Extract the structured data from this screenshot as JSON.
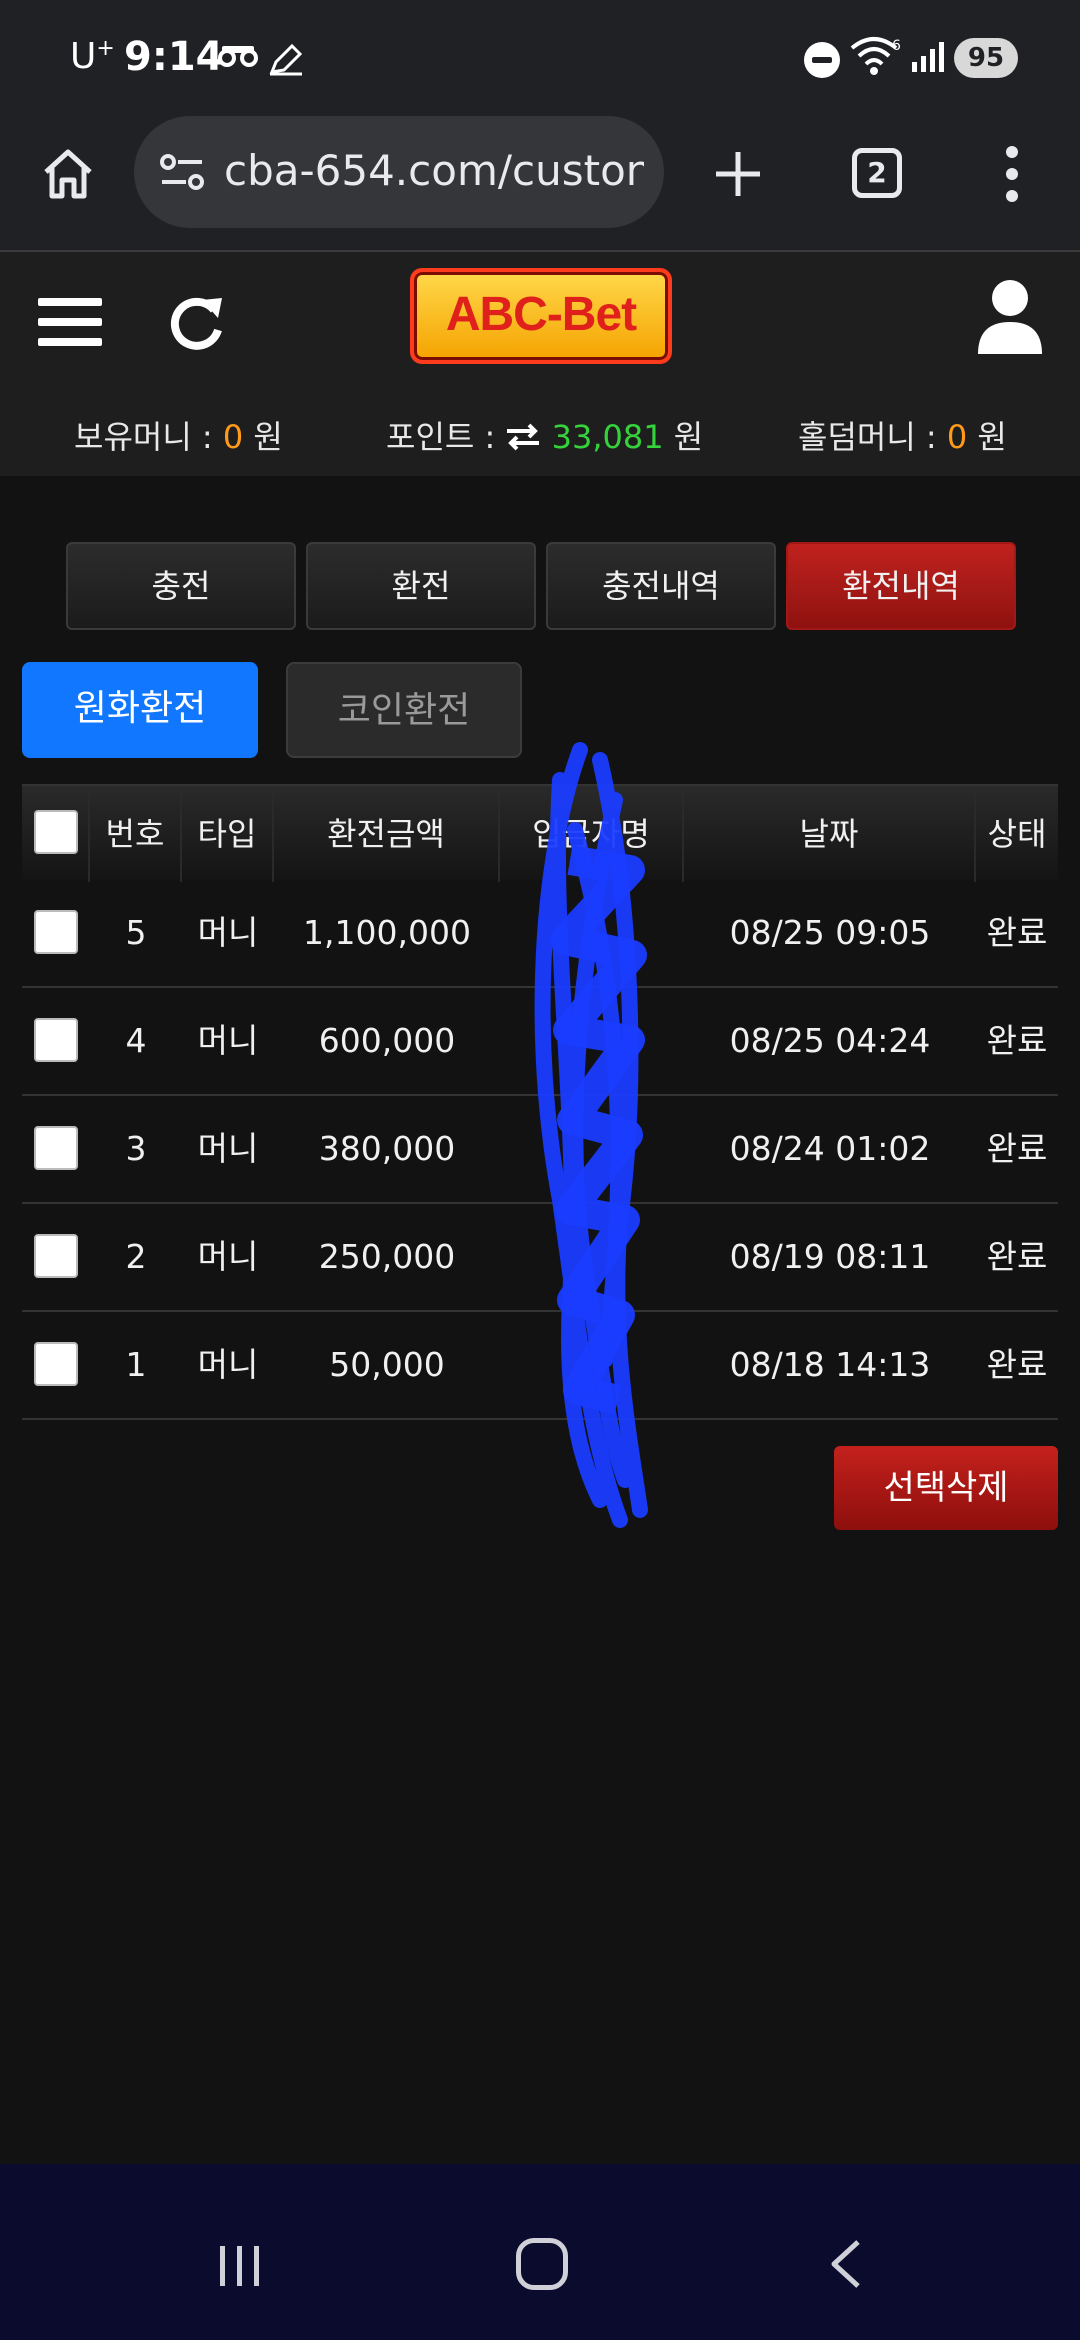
{
  "status_bar": {
    "carrier": "U",
    "carrier_sup": "+",
    "time": "9:14",
    "battery": "95"
  },
  "browser": {
    "url": "cba-654.com/custon",
    "tab_count": "2"
  },
  "site": {
    "logo_text": "ABC-Bet",
    "balances": {
      "money_label": "보유머니 : ",
      "money_value": "0",
      "money_unit": " 원",
      "point_label": "포인트 : ",
      "point_value": "33,081",
      "point_unit": " 원",
      "hold_label": "홀덤머니 : ",
      "hold_value": "0",
      "hold_unit": " 원"
    },
    "colors": {
      "accent_red": "#b01a17",
      "accent_blue": "#1177ff",
      "orange": "#ff9a1a",
      "green": "#35d33b"
    }
  },
  "main_tabs": [
    {
      "label": "충전"
    },
    {
      "label": "환전"
    },
    {
      "label": "충전내역"
    },
    {
      "label": "환전내역"
    }
  ],
  "sub_tabs": {
    "krw": "원화환전",
    "coin": "코인환전"
  },
  "table": {
    "headers": {
      "no": "번호",
      "type": "타입",
      "amount": "환전금액",
      "depositor": "입금자명",
      "date": "날짜",
      "status": "상태"
    },
    "rows": [
      {
        "no": "5",
        "type": "머니",
        "amount": "1,100,000",
        "date": "08/25 09:05",
        "status": "완료"
      },
      {
        "no": "4",
        "type": "머니",
        "amount": "600,000",
        "date": "08/25 04:24",
        "status": "완료"
      },
      {
        "no": "3",
        "type": "머니",
        "amount": "380,000",
        "date": "08/24 01:02",
        "status": "완료"
      },
      {
        "no": "2",
        "type": "머니",
        "amount": "250,000",
        "date": "08/19 08:11",
        "status": "완료"
      },
      {
        "no": "1",
        "type": "머니",
        "amount": "50,000",
        "date": "08/18 14:13",
        "status": "완료"
      }
    ]
  },
  "delete_button": "선택삭제"
}
